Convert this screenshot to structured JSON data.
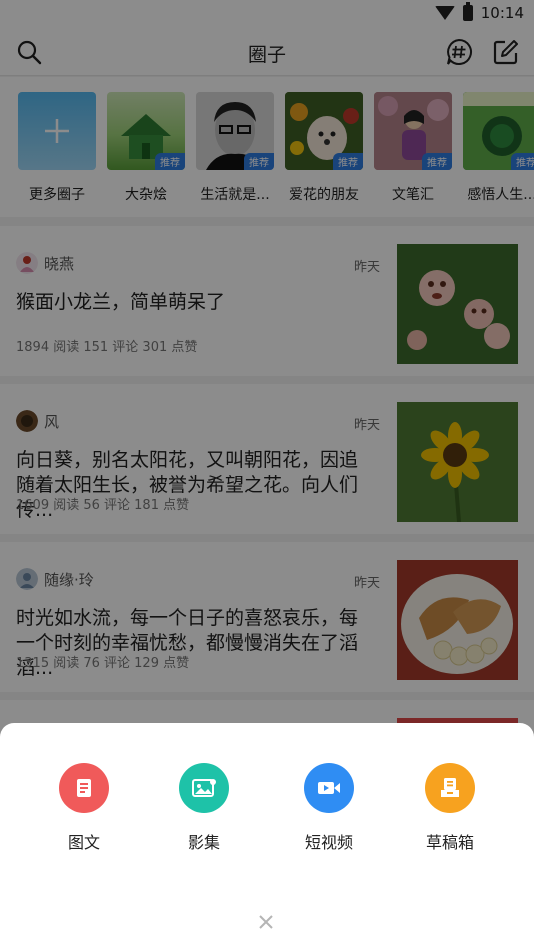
{
  "status": {
    "time": "10:14"
  },
  "header": {
    "title": "圈子"
  },
  "circles": [
    {
      "label": "更多圈子",
      "tag": ""
    },
    {
      "label": "大杂烩",
      "tag": "推荐"
    },
    {
      "label": "生活就是...",
      "tag": "推荐"
    },
    {
      "label": "爱花的朋友",
      "tag": "推荐"
    },
    {
      "label": "文笔汇",
      "tag": "推荐"
    },
    {
      "label": "感悟人生...",
      "tag": "推荐"
    }
  ],
  "posts": [
    {
      "user": "晓燕",
      "time": "昨天",
      "title": "猴面小龙兰，简单萌呆了",
      "stats": "1894 阅读  151 评论  301 点赞",
      "image_icon": "monkey-orchid-photo"
    },
    {
      "user": "风",
      "time": "昨天",
      "title": "向日葵，别名太阳花，又叫朝阳花，因追随着太阳生长，被誉为希望之花。向人们传...",
      "stats": "1609 阅读  56 评论  181 点赞",
      "image_icon": "sunflower-photo"
    },
    {
      "user": "随缘·玲",
      "time": "昨天",
      "title": "时光如水流，每一个日子的喜怒哀乐，每一个时刻的幸福忧愁，都慢慢消失在了滔滔...",
      "stats": "1315 阅读  76 评论  129 点赞",
      "image_icon": "pastry-photo"
    }
  ],
  "sheet": {
    "actions": [
      {
        "label": "图文",
        "color": "#f05a5a",
        "icon": "article-icon"
      },
      {
        "label": "影集",
        "color": "#1ec2a8",
        "icon": "album-icon"
      },
      {
        "label": "短视频",
        "color": "#2f8df3",
        "icon": "video-icon"
      },
      {
        "label": "草稿箱",
        "color": "#f7a21f",
        "icon": "drafts-icon"
      }
    ]
  }
}
